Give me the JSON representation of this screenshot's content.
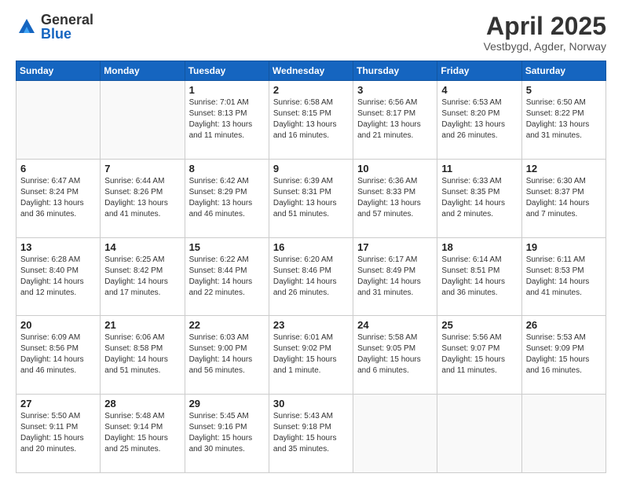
{
  "header": {
    "logo_general": "General",
    "logo_blue": "Blue",
    "month_title": "April 2025",
    "location": "Vestbygd, Agder, Norway"
  },
  "weekdays": [
    "Sunday",
    "Monday",
    "Tuesday",
    "Wednesday",
    "Thursday",
    "Friday",
    "Saturday"
  ],
  "days": [
    {
      "num": "",
      "sunrise": "",
      "sunset": "",
      "daylight": ""
    },
    {
      "num": "",
      "sunrise": "",
      "sunset": "",
      "daylight": ""
    },
    {
      "num": "1",
      "sunrise": "Sunrise: 7:01 AM",
      "sunset": "Sunset: 8:13 PM",
      "daylight": "Daylight: 13 hours and 11 minutes."
    },
    {
      "num": "2",
      "sunrise": "Sunrise: 6:58 AM",
      "sunset": "Sunset: 8:15 PM",
      "daylight": "Daylight: 13 hours and 16 minutes."
    },
    {
      "num": "3",
      "sunrise": "Sunrise: 6:56 AM",
      "sunset": "Sunset: 8:17 PM",
      "daylight": "Daylight: 13 hours and 21 minutes."
    },
    {
      "num": "4",
      "sunrise": "Sunrise: 6:53 AM",
      "sunset": "Sunset: 8:20 PM",
      "daylight": "Daylight: 13 hours and 26 minutes."
    },
    {
      "num": "5",
      "sunrise": "Sunrise: 6:50 AM",
      "sunset": "Sunset: 8:22 PM",
      "daylight": "Daylight: 13 hours and 31 minutes."
    },
    {
      "num": "6",
      "sunrise": "Sunrise: 6:47 AM",
      "sunset": "Sunset: 8:24 PM",
      "daylight": "Daylight: 13 hours and 36 minutes."
    },
    {
      "num": "7",
      "sunrise": "Sunrise: 6:44 AM",
      "sunset": "Sunset: 8:26 PM",
      "daylight": "Daylight: 13 hours and 41 minutes."
    },
    {
      "num": "8",
      "sunrise": "Sunrise: 6:42 AM",
      "sunset": "Sunset: 8:29 PM",
      "daylight": "Daylight: 13 hours and 46 minutes."
    },
    {
      "num": "9",
      "sunrise": "Sunrise: 6:39 AM",
      "sunset": "Sunset: 8:31 PM",
      "daylight": "Daylight: 13 hours and 51 minutes."
    },
    {
      "num": "10",
      "sunrise": "Sunrise: 6:36 AM",
      "sunset": "Sunset: 8:33 PM",
      "daylight": "Daylight: 13 hours and 57 minutes."
    },
    {
      "num": "11",
      "sunrise": "Sunrise: 6:33 AM",
      "sunset": "Sunset: 8:35 PM",
      "daylight": "Daylight: 14 hours and 2 minutes."
    },
    {
      "num": "12",
      "sunrise": "Sunrise: 6:30 AM",
      "sunset": "Sunset: 8:37 PM",
      "daylight": "Daylight: 14 hours and 7 minutes."
    },
    {
      "num": "13",
      "sunrise": "Sunrise: 6:28 AM",
      "sunset": "Sunset: 8:40 PM",
      "daylight": "Daylight: 14 hours and 12 minutes."
    },
    {
      "num": "14",
      "sunrise": "Sunrise: 6:25 AM",
      "sunset": "Sunset: 8:42 PM",
      "daylight": "Daylight: 14 hours and 17 minutes."
    },
    {
      "num": "15",
      "sunrise": "Sunrise: 6:22 AM",
      "sunset": "Sunset: 8:44 PM",
      "daylight": "Daylight: 14 hours and 22 minutes."
    },
    {
      "num": "16",
      "sunrise": "Sunrise: 6:20 AM",
      "sunset": "Sunset: 8:46 PM",
      "daylight": "Daylight: 14 hours and 26 minutes."
    },
    {
      "num": "17",
      "sunrise": "Sunrise: 6:17 AM",
      "sunset": "Sunset: 8:49 PM",
      "daylight": "Daylight: 14 hours and 31 minutes."
    },
    {
      "num": "18",
      "sunrise": "Sunrise: 6:14 AM",
      "sunset": "Sunset: 8:51 PM",
      "daylight": "Daylight: 14 hours and 36 minutes."
    },
    {
      "num": "19",
      "sunrise": "Sunrise: 6:11 AM",
      "sunset": "Sunset: 8:53 PM",
      "daylight": "Daylight: 14 hours and 41 minutes."
    },
    {
      "num": "20",
      "sunrise": "Sunrise: 6:09 AM",
      "sunset": "Sunset: 8:56 PM",
      "daylight": "Daylight: 14 hours and 46 minutes."
    },
    {
      "num": "21",
      "sunrise": "Sunrise: 6:06 AM",
      "sunset": "Sunset: 8:58 PM",
      "daylight": "Daylight: 14 hours and 51 minutes."
    },
    {
      "num": "22",
      "sunrise": "Sunrise: 6:03 AM",
      "sunset": "Sunset: 9:00 PM",
      "daylight": "Daylight: 14 hours and 56 minutes."
    },
    {
      "num": "23",
      "sunrise": "Sunrise: 6:01 AM",
      "sunset": "Sunset: 9:02 PM",
      "daylight": "Daylight: 15 hours and 1 minute."
    },
    {
      "num": "24",
      "sunrise": "Sunrise: 5:58 AM",
      "sunset": "Sunset: 9:05 PM",
      "daylight": "Daylight: 15 hours and 6 minutes."
    },
    {
      "num": "25",
      "sunrise": "Sunrise: 5:56 AM",
      "sunset": "Sunset: 9:07 PM",
      "daylight": "Daylight: 15 hours and 11 minutes."
    },
    {
      "num": "26",
      "sunrise": "Sunrise: 5:53 AM",
      "sunset": "Sunset: 9:09 PM",
      "daylight": "Daylight: 15 hours and 16 minutes."
    },
    {
      "num": "27",
      "sunrise": "Sunrise: 5:50 AM",
      "sunset": "Sunset: 9:11 PM",
      "daylight": "Daylight: 15 hours and 20 minutes."
    },
    {
      "num": "28",
      "sunrise": "Sunrise: 5:48 AM",
      "sunset": "Sunset: 9:14 PM",
      "daylight": "Daylight: 15 hours and 25 minutes."
    },
    {
      "num": "29",
      "sunrise": "Sunrise: 5:45 AM",
      "sunset": "Sunset: 9:16 PM",
      "daylight": "Daylight: 15 hours and 30 minutes."
    },
    {
      "num": "30",
      "sunrise": "Sunrise: 5:43 AM",
      "sunset": "Sunset: 9:18 PM",
      "daylight": "Daylight: 15 hours and 35 minutes."
    },
    {
      "num": "",
      "sunrise": "",
      "sunset": "",
      "daylight": ""
    },
    {
      "num": "",
      "sunrise": "",
      "sunset": "",
      "daylight": ""
    },
    {
      "num": "",
      "sunrise": "",
      "sunset": "",
      "daylight": ""
    }
  ]
}
